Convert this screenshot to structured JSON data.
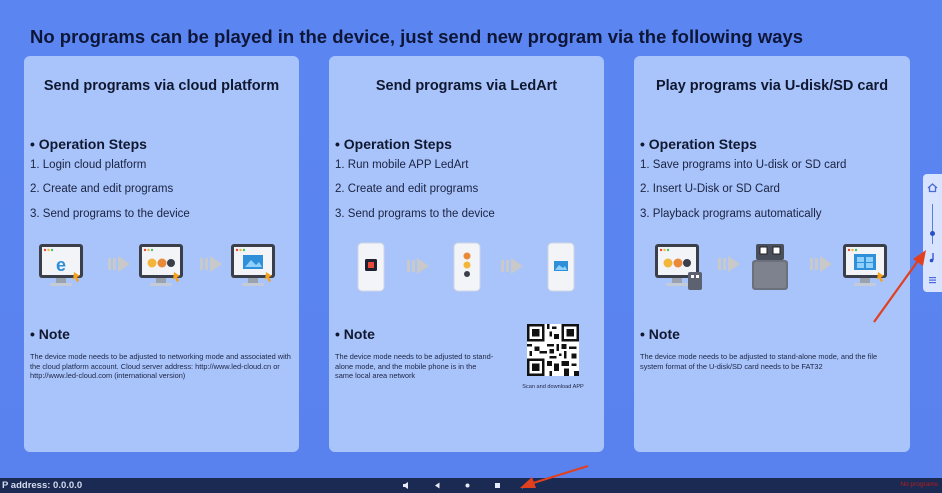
{
  "headline": "No programs can be played in the device, just send new program via the following ways",
  "panels": [
    {
      "title": "Send programs via cloud platform",
      "steps_heading": "• Operation Steps",
      "steps": [
        "1. Login cloud platform",
        "2. Create and edit programs",
        "3. Send programs to the device"
      ],
      "note_heading": "• Note",
      "note": "The device mode needs to be adjusted to networking mode and associated with the cloud platform account. Cloud server address: http://www.led-cloud.cn or http://www.led-cloud.com (international version)"
    },
    {
      "title": "Send programs via LedArt",
      "steps_heading": "• Operation Steps",
      "steps": [
        "1. Run mobile APP LedArt",
        "2. Create and edit programs",
        "3. Send programs to the device"
      ],
      "note_heading": "• Note",
      "note": "The device mode needs to be adjusted to stand-alone mode, and the mobile phone is in the same local area network",
      "qr_caption": "Scan and download APP"
    },
    {
      "title": "Play programs via U-disk/SD card",
      "steps_heading": "• Operation Steps",
      "steps": [
        "1. Save programs into U-disk or SD card",
        "2. Insert U-Disk or SD Card",
        "3. Playback programs automatically"
      ],
      "note_heading": "• Note",
      "note": "The device mode needs to be adjusted to stand-alone mode, and the file system format of the U-disk/SD card needs to be FAT32"
    }
  ],
  "bottom_bar": {
    "ip_label": "P address: 0.0.0.0",
    "status_right": "No programs"
  },
  "colors": {
    "background": "#5a84f0",
    "panel": "#a9c3fb",
    "bottom_bar": "#1b2a52",
    "annotation": "#e0401e",
    "monitor_screen": "#2f8fd8",
    "arrow_gray": "#c9c9c9"
  },
  "icons": {
    "flow_1": [
      "monitor-browser-icon",
      "arrow-right-icon",
      "monitor-editor-icon",
      "arrow-right-icon",
      "monitor-send-icon"
    ],
    "flow_2": [
      "phone-app-icon",
      "arrow-right-icon",
      "phone-editor-icon",
      "arrow-right-icon",
      "phone-send-icon"
    ],
    "flow_3": [
      "monitor-usb-icon",
      "arrow-right-icon",
      "usb-disk-icon",
      "arrow-right-icon",
      "monitor-play-icon"
    ],
    "side_toolbar": [
      "home-icon",
      "slider-icon",
      "music-note-icon",
      "menu-icon"
    ],
    "nav": [
      "volume-icon",
      "back-icon",
      "home-dot-icon",
      "recent-apps-icon",
      "screenshot-icon"
    ]
  }
}
